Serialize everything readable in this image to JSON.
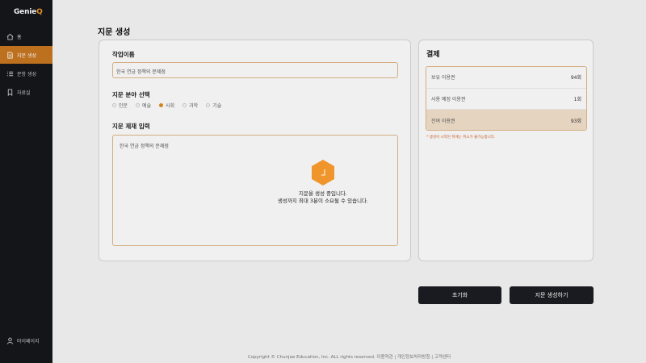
{
  "app": {
    "logo_text": "Genie",
    "logo_accent": "Q"
  },
  "sidebar": {
    "items": [
      {
        "label": "홈",
        "icon": "home-icon"
      },
      {
        "label": "지문 생성",
        "icon": "document-icon",
        "active": true
      },
      {
        "label": "문항 생성",
        "icon": "list-icon"
      },
      {
        "label": "자료실",
        "icon": "bookmark-icon"
      }
    ],
    "mypage": {
      "label": "마이페이지",
      "icon": "user-icon"
    }
  },
  "page": {
    "title": "지문 생성"
  },
  "form": {
    "work_name_label": "작업이름",
    "work_name_value": "한국 연금 정책의 문제점",
    "field_label": "지문 분야 선택",
    "fields": [
      {
        "label": "인문",
        "selected": false
      },
      {
        "label": "예술",
        "selected": false
      },
      {
        "label": "사회",
        "selected": true
      },
      {
        "label": "과학",
        "selected": false
      },
      {
        "label": "기술",
        "selected": false
      }
    ],
    "topic_label": "지문 제재 입력",
    "topic_value": "한국 연금 정책의 문제점"
  },
  "payment": {
    "title": "결제",
    "rows": [
      {
        "label": "보유 이용권",
        "value": "94회"
      },
      {
        "label": "사용 예정 이용권",
        "value": "1회"
      },
      {
        "label": "잔여 이용권",
        "value": "93회"
      }
    ],
    "note": "* 생성이 시작된 뒤에는 취소가 불가능합니다."
  },
  "buttons": {
    "reset": "초기화",
    "generate": "지문 생성하기"
  },
  "loading": {
    "line1": "지문을 생성 중입니다.",
    "line2": "생성까지 최대 3분이 소요될 수 있습니다.",
    "icon": "hexagon-loader-icon"
  },
  "footer": {
    "text": "Copyright © Chunjae Education, Inc. ALL rights reserved. 이용약관 | 개인정보처리방침 | 고객센터"
  },
  "colors": {
    "accent": "#e08a1e",
    "sidebar_bg": "#15171b",
    "button_bg": "#1b1d22"
  }
}
